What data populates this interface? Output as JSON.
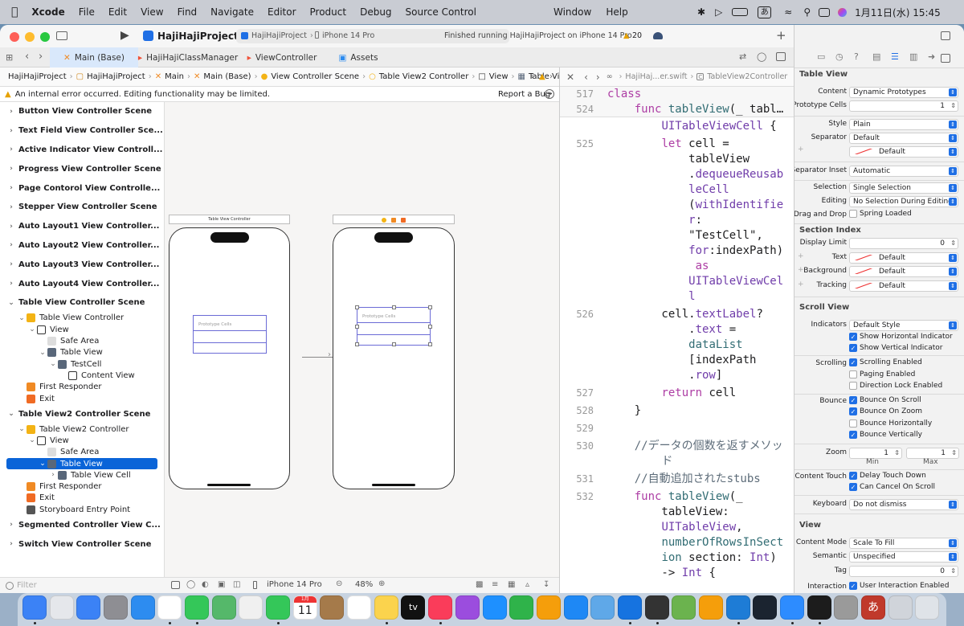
{
  "menubar": {
    "app": "Xcode",
    "items": [
      "File",
      "Edit",
      "View",
      "Find",
      "Navigate",
      "Editor",
      "Product",
      "Debug",
      "Source Control"
    ],
    "right_items": [
      "Window",
      "Help"
    ],
    "ime": "あ",
    "clock": "1月11日(水)  15:45"
  },
  "toolbar": {
    "project": "HajiHajiProject",
    "scheme": "HajiHajiProject",
    "destination": "iPhone 14 Pro",
    "status": "Finished running HajiHajiProject on iPhone 14 Pro",
    "warnings": "20"
  },
  "tabs": [
    {
      "label": "Main (Base)",
      "active": true
    },
    {
      "label": "HajiHajiClassManager",
      "active": false
    },
    {
      "label": "ViewController",
      "active": false
    },
    {
      "label": "Assets",
      "active": false
    }
  ],
  "jumpbar": [
    "HajiHajiProject",
    "HajiHajiProject",
    "Main",
    "Main (Base)",
    "View Controller Scene",
    "Table View2 Controller",
    "View",
    "Table View"
  ],
  "warning_bar": {
    "text": "An internal error occurred. Editing functionality may be limited.",
    "action": "Report a Bug"
  },
  "outline": [
    {
      "label": "Button View Controller Scene",
      "level": 0,
      "scene": true,
      "disc": "›"
    },
    {
      "label": "Text Field View Controller Sce...",
      "level": 0,
      "scene": true,
      "disc": "›"
    },
    {
      "label": "Active Indicator View Controll...",
      "level": 0,
      "scene": true,
      "disc": "›"
    },
    {
      "label": "Progress View Controller Scene",
      "level": 0,
      "scene": true,
      "disc": "›"
    },
    {
      "label": "Page Contorol View Controlle...",
      "level": 0,
      "scene": true,
      "disc": "›"
    },
    {
      "label": "Stepper View Controller Scene",
      "level": 0,
      "scene": true,
      "disc": "›"
    },
    {
      "label": "Auto Layout1 View Controller...",
      "level": 0,
      "scene": true,
      "disc": "›"
    },
    {
      "label": "Auto Layout2 View Controller...",
      "level": 0,
      "scene": true,
      "disc": "›"
    },
    {
      "label": "Auto Layout3 View Controller...",
      "level": 0,
      "scene": true,
      "disc": "›"
    },
    {
      "label": "Auto Layout4 View Controller...",
      "level": 0,
      "scene": true,
      "disc": "›"
    },
    {
      "label": "Table View Controller Scene",
      "level": 0,
      "scene": true,
      "disc": "⌄"
    },
    {
      "label": "Table View Controller",
      "level": 1,
      "disc": "⌄",
      "icon": "#f3b315"
    },
    {
      "label": "View",
      "level": 2,
      "disc": "⌄",
      "icon": "#fff"
    },
    {
      "label": "Safe Area",
      "level": 3,
      "disc": "",
      "icon": "#ddd"
    },
    {
      "label": "Table View",
      "level": 3,
      "disc": "⌄",
      "icon": "#59677a"
    },
    {
      "label": "TestCell",
      "level": 4,
      "disc": "⌄",
      "icon": "#59677a"
    },
    {
      "label": "Content View",
      "level": 5,
      "disc": "",
      "icon": "#fff"
    },
    {
      "label": "First Responder",
      "level": 1,
      "disc": "",
      "icon": "#f08a24"
    },
    {
      "label": "Exit",
      "level": 1,
      "disc": "",
      "icon": "#f06b24"
    },
    {
      "label": "Table View2 Controller Scene",
      "level": 0,
      "scene": true,
      "disc": "⌄"
    },
    {
      "label": "Table View2 Controller",
      "level": 1,
      "disc": "⌄",
      "icon": "#f3b315"
    },
    {
      "label": "View",
      "level": 2,
      "disc": "⌄",
      "icon": "#fff"
    },
    {
      "label": "Safe Area",
      "level": 3,
      "disc": "",
      "icon": "#ddd"
    },
    {
      "label": "Table View",
      "level": 3,
      "disc": "⌄",
      "icon": "#59677a",
      "selected": true
    },
    {
      "label": "Table View Cell",
      "level": 4,
      "disc": "›",
      "icon": "#59677a"
    },
    {
      "label": "First Responder",
      "level": 1,
      "disc": "",
      "icon": "#f08a24"
    },
    {
      "label": "Exit",
      "level": 1,
      "disc": "",
      "icon": "#f06b24"
    },
    {
      "label": "Storyboard Entry Point",
      "level": 1,
      "disc": "",
      "icon": "#555"
    },
    {
      "label": "Segmented Controller View C...",
      "level": 0,
      "scene": true,
      "disc": "›"
    },
    {
      "label": "Switch View Controller Scene",
      "level": 0,
      "scene": true,
      "disc": "›"
    }
  ],
  "filter_placeholder": "Filter",
  "canvas": {
    "scene1_title": "Table View Controller",
    "prototype_cells_1": "Prototype Cells",
    "prototype_cells_2": "Prototype Cells"
  },
  "bottombar": {
    "device": "iPhone 14 Pro",
    "zoom": "48%"
  },
  "editor": {
    "jump": [
      "HajiHaj...er.swift",
      "TableView2Controller"
    ],
    "sticky": [
      {
        "num": "517",
        "code": [
          [
            "kw",
            "class"
          ]
        ]
      },
      {
        "num": "524",
        "code": [
          [
            "plain",
            "    "
          ],
          [
            "kw",
            "func "
          ],
          [
            "fn",
            "tableView"
          ],
          [
            "plain",
            "(_ tabl…"
          ]
        ]
      }
    ],
    "lines": [
      {
        "num": "",
        "code": [
          [
            "plain",
            "        "
          ],
          [
            "ty",
            "UITableViewCell"
          ],
          [
            "plain",
            " {"
          ]
        ]
      },
      {
        "num": "525",
        "code": [
          [
            "plain",
            "        "
          ],
          [
            "kw",
            "let"
          ],
          [
            "plain",
            " cell ="
          ]
        ]
      },
      {
        "num": "",
        "code": [
          [
            "plain",
            "            tableView"
          ]
        ]
      },
      {
        "num": "",
        "code": [
          [
            "plain",
            "            ."
          ],
          [
            "ty",
            "dequeueReusab"
          ]
        ]
      },
      {
        "num": "",
        "code": [
          [
            "plain",
            "            "
          ],
          [
            "ty",
            "leCell"
          ]
        ]
      },
      {
        "num": "",
        "code": [
          [
            "plain",
            "            ("
          ],
          [
            "ty",
            "withIdentifie"
          ]
        ]
      },
      {
        "num": "",
        "code": [
          [
            "plain",
            "            "
          ],
          [
            "ty",
            "r"
          ],
          [
            "plain",
            ":"
          ]
        ]
      },
      {
        "num": "",
        "code": [
          [
            "plain",
            "            \"TestCell\","
          ]
        ]
      },
      {
        "num": "",
        "code": [
          [
            "plain",
            "            "
          ],
          [
            "ty",
            "for"
          ],
          [
            "plain",
            ":indexPath)"
          ]
        ]
      },
      {
        "num": "",
        "code": [
          [
            "plain",
            "             "
          ],
          [
            "kw",
            "as"
          ]
        ]
      },
      {
        "num": "",
        "code": [
          [
            "plain",
            "            "
          ],
          [
            "ty",
            "UITableViewCel"
          ]
        ]
      },
      {
        "num": "",
        "code": [
          [
            "plain",
            "            "
          ],
          [
            "ty",
            "l"
          ]
        ]
      },
      {
        "num": "526",
        "code": [
          [
            "plain",
            "        cell."
          ],
          [
            "ty",
            "textLabel"
          ],
          [
            "plain",
            "?"
          ]
        ]
      },
      {
        "num": "",
        "code": [
          [
            "plain",
            "            ."
          ],
          [
            "ty",
            "text"
          ],
          [
            "plain",
            " ="
          ]
        ]
      },
      {
        "num": "",
        "code": [
          [
            "plain",
            "            "
          ],
          [
            "fn",
            "dataList"
          ]
        ]
      },
      {
        "num": "",
        "code": [
          [
            "plain",
            "            [indexPath"
          ]
        ]
      },
      {
        "num": "",
        "code": [
          [
            "plain",
            "            ."
          ],
          [
            "ty",
            "row"
          ],
          [
            "plain",
            "]"
          ]
        ]
      },
      {
        "num": "527",
        "code": [
          [
            "plain",
            "        "
          ],
          [
            "kw",
            "return"
          ],
          [
            "plain",
            " cell"
          ]
        ]
      },
      {
        "num": "528",
        "code": [
          [
            "plain",
            "    }"
          ]
        ]
      },
      {
        "num": "529",
        "code": [
          [
            "plain",
            ""
          ]
        ]
      },
      {
        "num": "530",
        "code": [
          [
            "cm",
            "    //データの個数を返すメソッ"
          ]
        ]
      },
      {
        "num": "",
        "code": [
          [
            "cm",
            "        ド"
          ]
        ]
      },
      {
        "num": "531",
        "code": [
          [
            "cm",
            "    //自動追加されたstubs"
          ]
        ]
      },
      {
        "num": "532",
        "code": [
          [
            "plain",
            "    "
          ],
          [
            "kw",
            "func "
          ],
          [
            "fn",
            "tableView"
          ],
          [
            "plain",
            "(_"
          ]
        ]
      },
      {
        "num": "",
        "code": [
          [
            "plain",
            "        tableView:"
          ]
        ]
      },
      {
        "num": "",
        "code": [
          [
            "plain",
            "        "
          ],
          [
            "ty",
            "UITableView"
          ],
          [
            "plain",
            ","
          ]
        ]
      },
      {
        "num": "",
        "code": [
          [
            "plain",
            "        "
          ],
          [
            "fn",
            "numberOfRowsInSect"
          ]
        ]
      },
      {
        "num": "",
        "code": [
          [
            "plain",
            "        "
          ],
          [
            "fn",
            "ion"
          ],
          [
            "plain",
            " section: "
          ],
          [
            "ty",
            "Int"
          ],
          [
            "plain",
            ")"
          ]
        ]
      },
      {
        "num": "",
        "code": [
          [
            "plain",
            "        -> "
          ],
          [
            "ty",
            "Int"
          ],
          [
            "plain",
            " {"
          ]
        ]
      }
    ]
  },
  "inspector": {
    "sections": {
      "table_view": "Table View",
      "section_index": "Section Index",
      "scroll_view": "Scroll View",
      "view": "View"
    },
    "content": {
      "label": "Content",
      "value": "Dynamic Prototypes"
    },
    "prototype_cells": {
      "label": "Prototype Cells",
      "value": "1"
    },
    "style": {
      "label": "Style",
      "value": "Plain"
    },
    "separator": {
      "label": "Separator",
      "value": "Default",
      "color": "Default"
    },
    "separator_inset": {
      "label": "Separator Inset",
      "value": "Automatic"
    },
    "selection": {
      "label": "Selection",
      "value": "Single Selection"
    },
    "editing": {
      "label": "Editing",
      "value": "No Selection During Editing"
    },
    "drag_drop": {
      "label": "Drag and Drop",
      "value": "Spring Loaded"
    },
    "display_limit": {
      "label": "Display Limit",
      "value": "0"
    },
    "text": {
      "label": "Text",
      "value": "Default"
    },
    "background": {
      "label": "Background",
      "value": "Default"
    },
    "tracking": {
      "label": "Tracking",
      "value": "Default"
    },
    "indicators": {
      "label": "Indicators",
      "value": "Default Style"
    },
    "show_h": "Show Horizontal Indicator",
    "show_v": "Show Vertical Indicator",
    "scrolling": {
      "label": "Scrolling",
      "value": "Scrolling Enabled"
    },
    "paging": "Paging Enabled",
    "direction_lock": "Direction Lock Enabled",
    "bounce": {
      "label": "Bounce",
      "value": "Bounce On Scroll"
    },
    "bounce_zoom": "Bounce On Zoom",
    "bounce_h": "Bounce Horizontally",
    "bounce_v": "Bounce Vertically",
    "zoom": {
      "label": "Zoom",
      "min": "1",
      "max": "1",
      "min_label": "Min",
      "max_label": "Max"
    },
    "content_touch": {
      "label": "Content Touch",
      "value": "Delay Touch Down"
    },
    "can_cancel": "Can Cancel On Scroll",
    "keyboard": {
      "label": "Keyboard",
      "value": "Do not dismiss"
    },
    "content_mode": {
      "label": "Content Mode",
      "value": "Scale To Fill"
    },
    "semantic": {
      "label": "Semantic",
      "value": "Unspecified"
    },
    "tag": {
      "label": "Tag",
      "value": "0"
    },
    "interaction": {
      "label": "Interaction",
      "value": "User Interaction Enabled"
    }
  },
  "dock": {
    "calendar_month": "1月",
    "calendar_day": "11",
    "tv_label": "tv",
    "ime_label": "あ",
    "apps": [
      {
        "name": "finder",
        "color": "#3b82f6"
      },
      {
        "name": "launchpad",
        "color": "#e5e7eb"
      },
      {
        "name": "mail",
        "color": "#3b82f6"
      },
      {
        "name": "system-settings",
        "color": "#8e8e93"
      },
      {
        "name": "safari",
        "color": "#2d8cf0"
      },
      {
        "name": "chrome",
        "color": "#ffffff"
      },
      {
        "name": "messages",
        "color": "#34c759"
      },
      {
        "name": "maps",
        "color": "#55b86a"
      },
      {
        "name": "photos",
        "color": "#f0f0f0"
      },
      {
        "name": "facetime",
        "color": "#34c759"
      },
      {
        "name": "calendar",
        "color": "#ffffff"
      },
      {
        "name": "notebook",
        "color": "#a57a4a"
      },
      {
        "name": "reminders",
        "color": "#ffffff"
      },
      {
        "name": "notes",
        "color": "#fbd34d"
      },
      {
        "name": "apple-tv",
        "color": "#111111"
      },
      {
        "name": "music",
        "color": "#fa3c5a"
      },
      {
        "name": "podcasts",
        "color": "#9b4dde"
      },
      {
        "name": "keynote",
        "color": "#1e90ff"
      },
      {
        "name": "numbers",
        "color": "#2fb34a"
      },
      {
        "name": "pages",
        "color": "#f59e0b"
      },
      {
        "name": "app-store",
        "color": "#1e88f5"
      },
      {
        "name": "preview",
        "color": "#5fa8e8"
      },
      {
        "name": "xcode",
        "color": "#1673e0"
      },
      {
        "name": "simulator",
        "color": "#333333"
      },
      {
        "name": "textedit",
        "color": "#6bb34e"
      },
      {
        "name": "books",
        "color": "#f59e0b"
      },
      {
        "name": "vscode",
        "color": "#1e7cd6"
      },
      {
        "name": "qr-app",
        "color": "#1b2430"
      },
      {
        "name": "zoom",
        "color": "#2d8cff"
      },
      {
        "name": "terminal",
        "color": "#1c1c1c"
      },
      {
        "name": "dictionary",
        "color": "#9a9a9a"
      },
      {
        "name": "ime-app",
        "color": "#c0392b"
      },
      {
        "name": "window",
        "color": "#d0d4da"
      },
      {
        "name": "trash",
        "color": "#dfe3e8"
      }
    ]
  }
}
